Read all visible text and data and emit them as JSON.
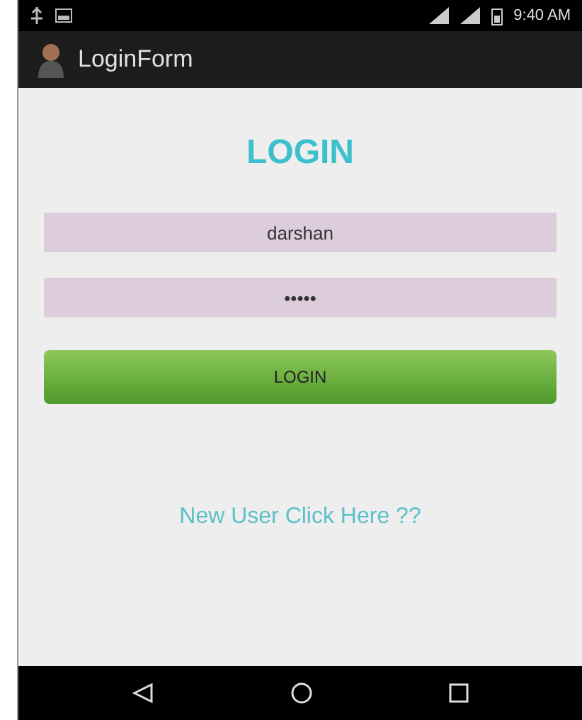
{
  "status_bar": {
    "time": "9:40 AM"
  },
  "app_bar": {
    "title": "LoginForm"
  },
  "heading": "LOGIN",
  "username": {
    "value": "darshan"
  },
  "password": {
    "value": "•••••"
  },
  "login_button": "LOGIN",
  "register_link": "New User Click Here ??"
}
